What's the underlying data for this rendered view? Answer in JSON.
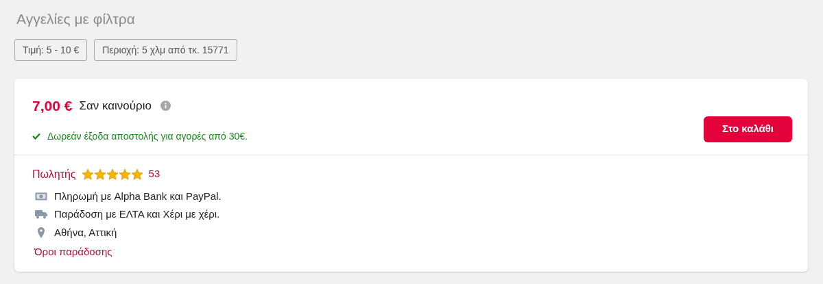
{
  "heading": "Αγγελίες με φίλτρα",
  "filters": [
    "Τιμή: 5 - 10 €",
    "Περιοχή: 5 χλμ από τκ. 15771"
  ],
  "offer": {
    "price": "7,00 €",
    "condition": "Σαν καινούριο",
    "shipping_note": "Δωρεάν έξοδα αποστολής για αγορές από 30€.",
    "cart_button": "Στο καλάθι"
  },
  "seller": {
    "label": "Πωλητής",
    "stars": 5,
    "rating_count": "53",
    "details": [
      {
        "kind": "payment",
        "text": "Πληρωμή με Alpha Bank και PayPal."
      },
      {
        "kind": "delivery",
        "text": "Παράδοση με ΕΛΤΑ και Χέρι με χέρι."
      },
      {
        "kind": "location",
        "text": "Αθήνα, Αττική"
      }
    ],
    "terms_link": "Όροι παράδοσης"
  }
}
